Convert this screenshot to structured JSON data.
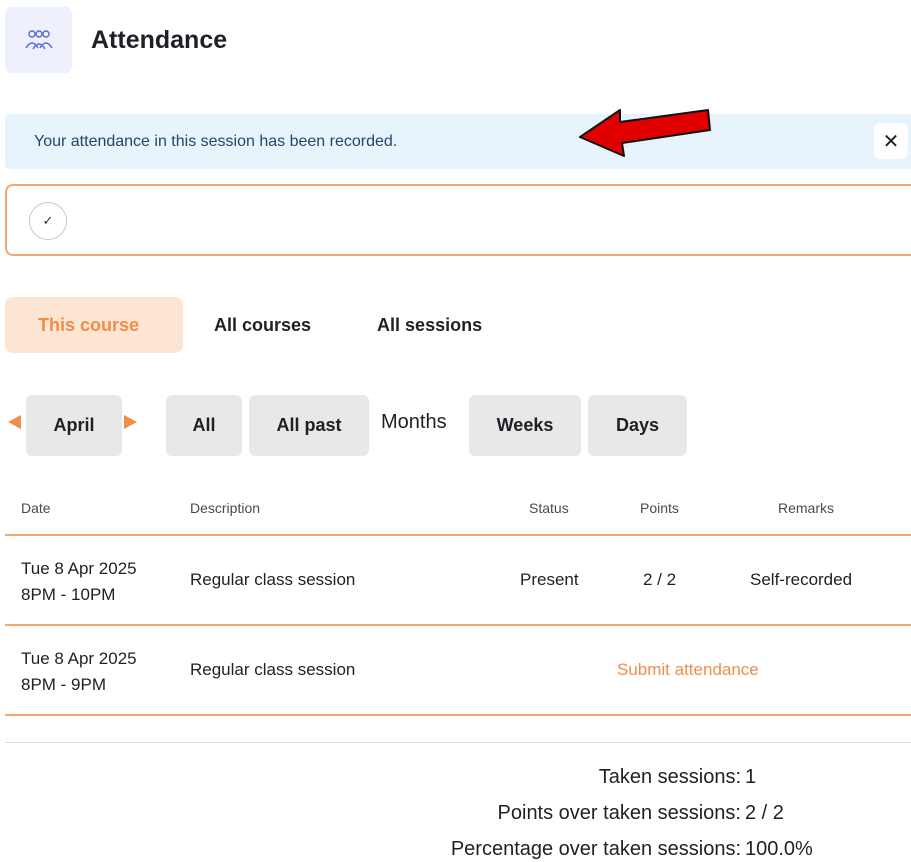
{
  "header": {
    "title": "Attendance",
    "icon": "users-icon"
  },
  "alert": {
    "message": "Your attendance in this session has been recorded.",
    "close_label": "✕"
  },
  "checkbox": {
    "mark": "✓"
  },
  "tabs": [
    {
      "label": "This course",
      "active": true
    },
    {
      "label": "All courses",
      "active": false
    },
    {
      "label": "All sessions",
      "active": false
    }
  ],
  "filters": {
    "current_month": "April",
    "all": "All",
    "all_past": "All past",
    "months": "Months",
    "weeks": "Weeks",
    "days": "Days"
  },
  "table": {
    "headers": {
      "date": "Date",
      "description": "Description",
      "status": "Status",
      "points": "Points",
      "remarks": "Remarks"
    },
    "rows": [
      {
        "date": "Tue 8 Apr 2025",
        "time": "8PM - 10PM",
        "description": "Regular class session",
        "status": "Present",
        "points": "2 / 2",
        "remarks": "Self-recorded"
      },
      {
        "date": "Tue 8 Apr 2025",
        "time": "8PM - 9PM",
        "description": "Regular class session",
        "action": "Submit attendance"
      }
    ]
  },
  "summary": {
    "taken_label": "Taken sessions:",
    "taken_value": "1",
    "points_label": "Points over taken sessions:",
    "points_value": "2 / 2",
    "percentage_label": "Percentage over taken sessions:",
    "percentage_value": "100.0%"
  },
  "colors": {
    "accent": "#f08d49",
    "alert_bg": "#e8f4fb",
    "arrow": "#e00000"
  }
}
